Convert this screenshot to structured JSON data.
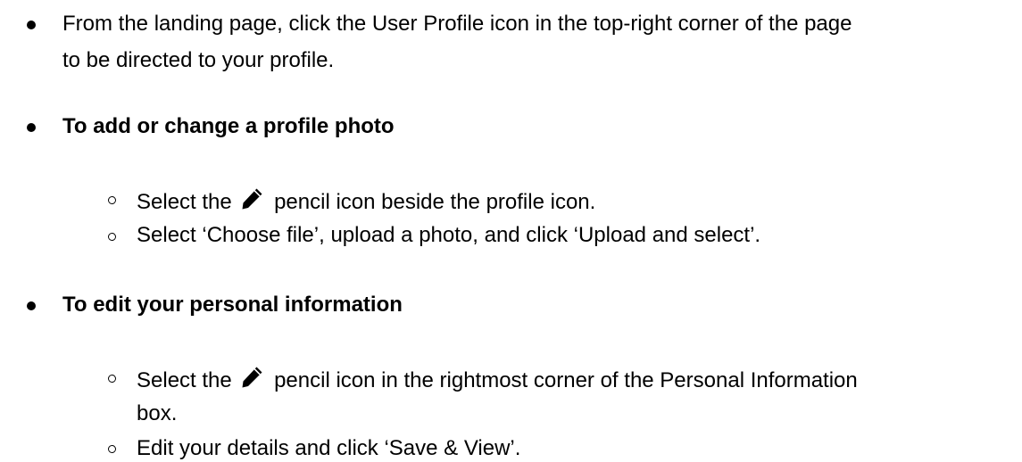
{
  "bullets": [
    {
      "lines": [
        "From the landing page, click the User Profile icon in the top-right corner of the page",
        "to be directed to your profile."
      ]
    },
    {
      "heading": "To add or change a profile photo",
      "sub": [
        {
          "before": "Select the",
          "icon": "pencil-icon",
          "after": "pencil icon beside the profile icon."
        },
        {
          "text": "Select ‘Choose file’, upload a photo, and click ‘Upload and select’."
        }
      ]
    },
    {
      "heading": "To edit your personal information",
      "sub": [
        {
          "before": "Select the",
          "icon": "pencil-icon",
          "after": "pencil icon in the rightmost corner of the Personal Information",
          "continuation": "box."
        },
        {
          "text": "Edit your details and click ‘Save & View’."
        }
      ]
    }
  ]
}
